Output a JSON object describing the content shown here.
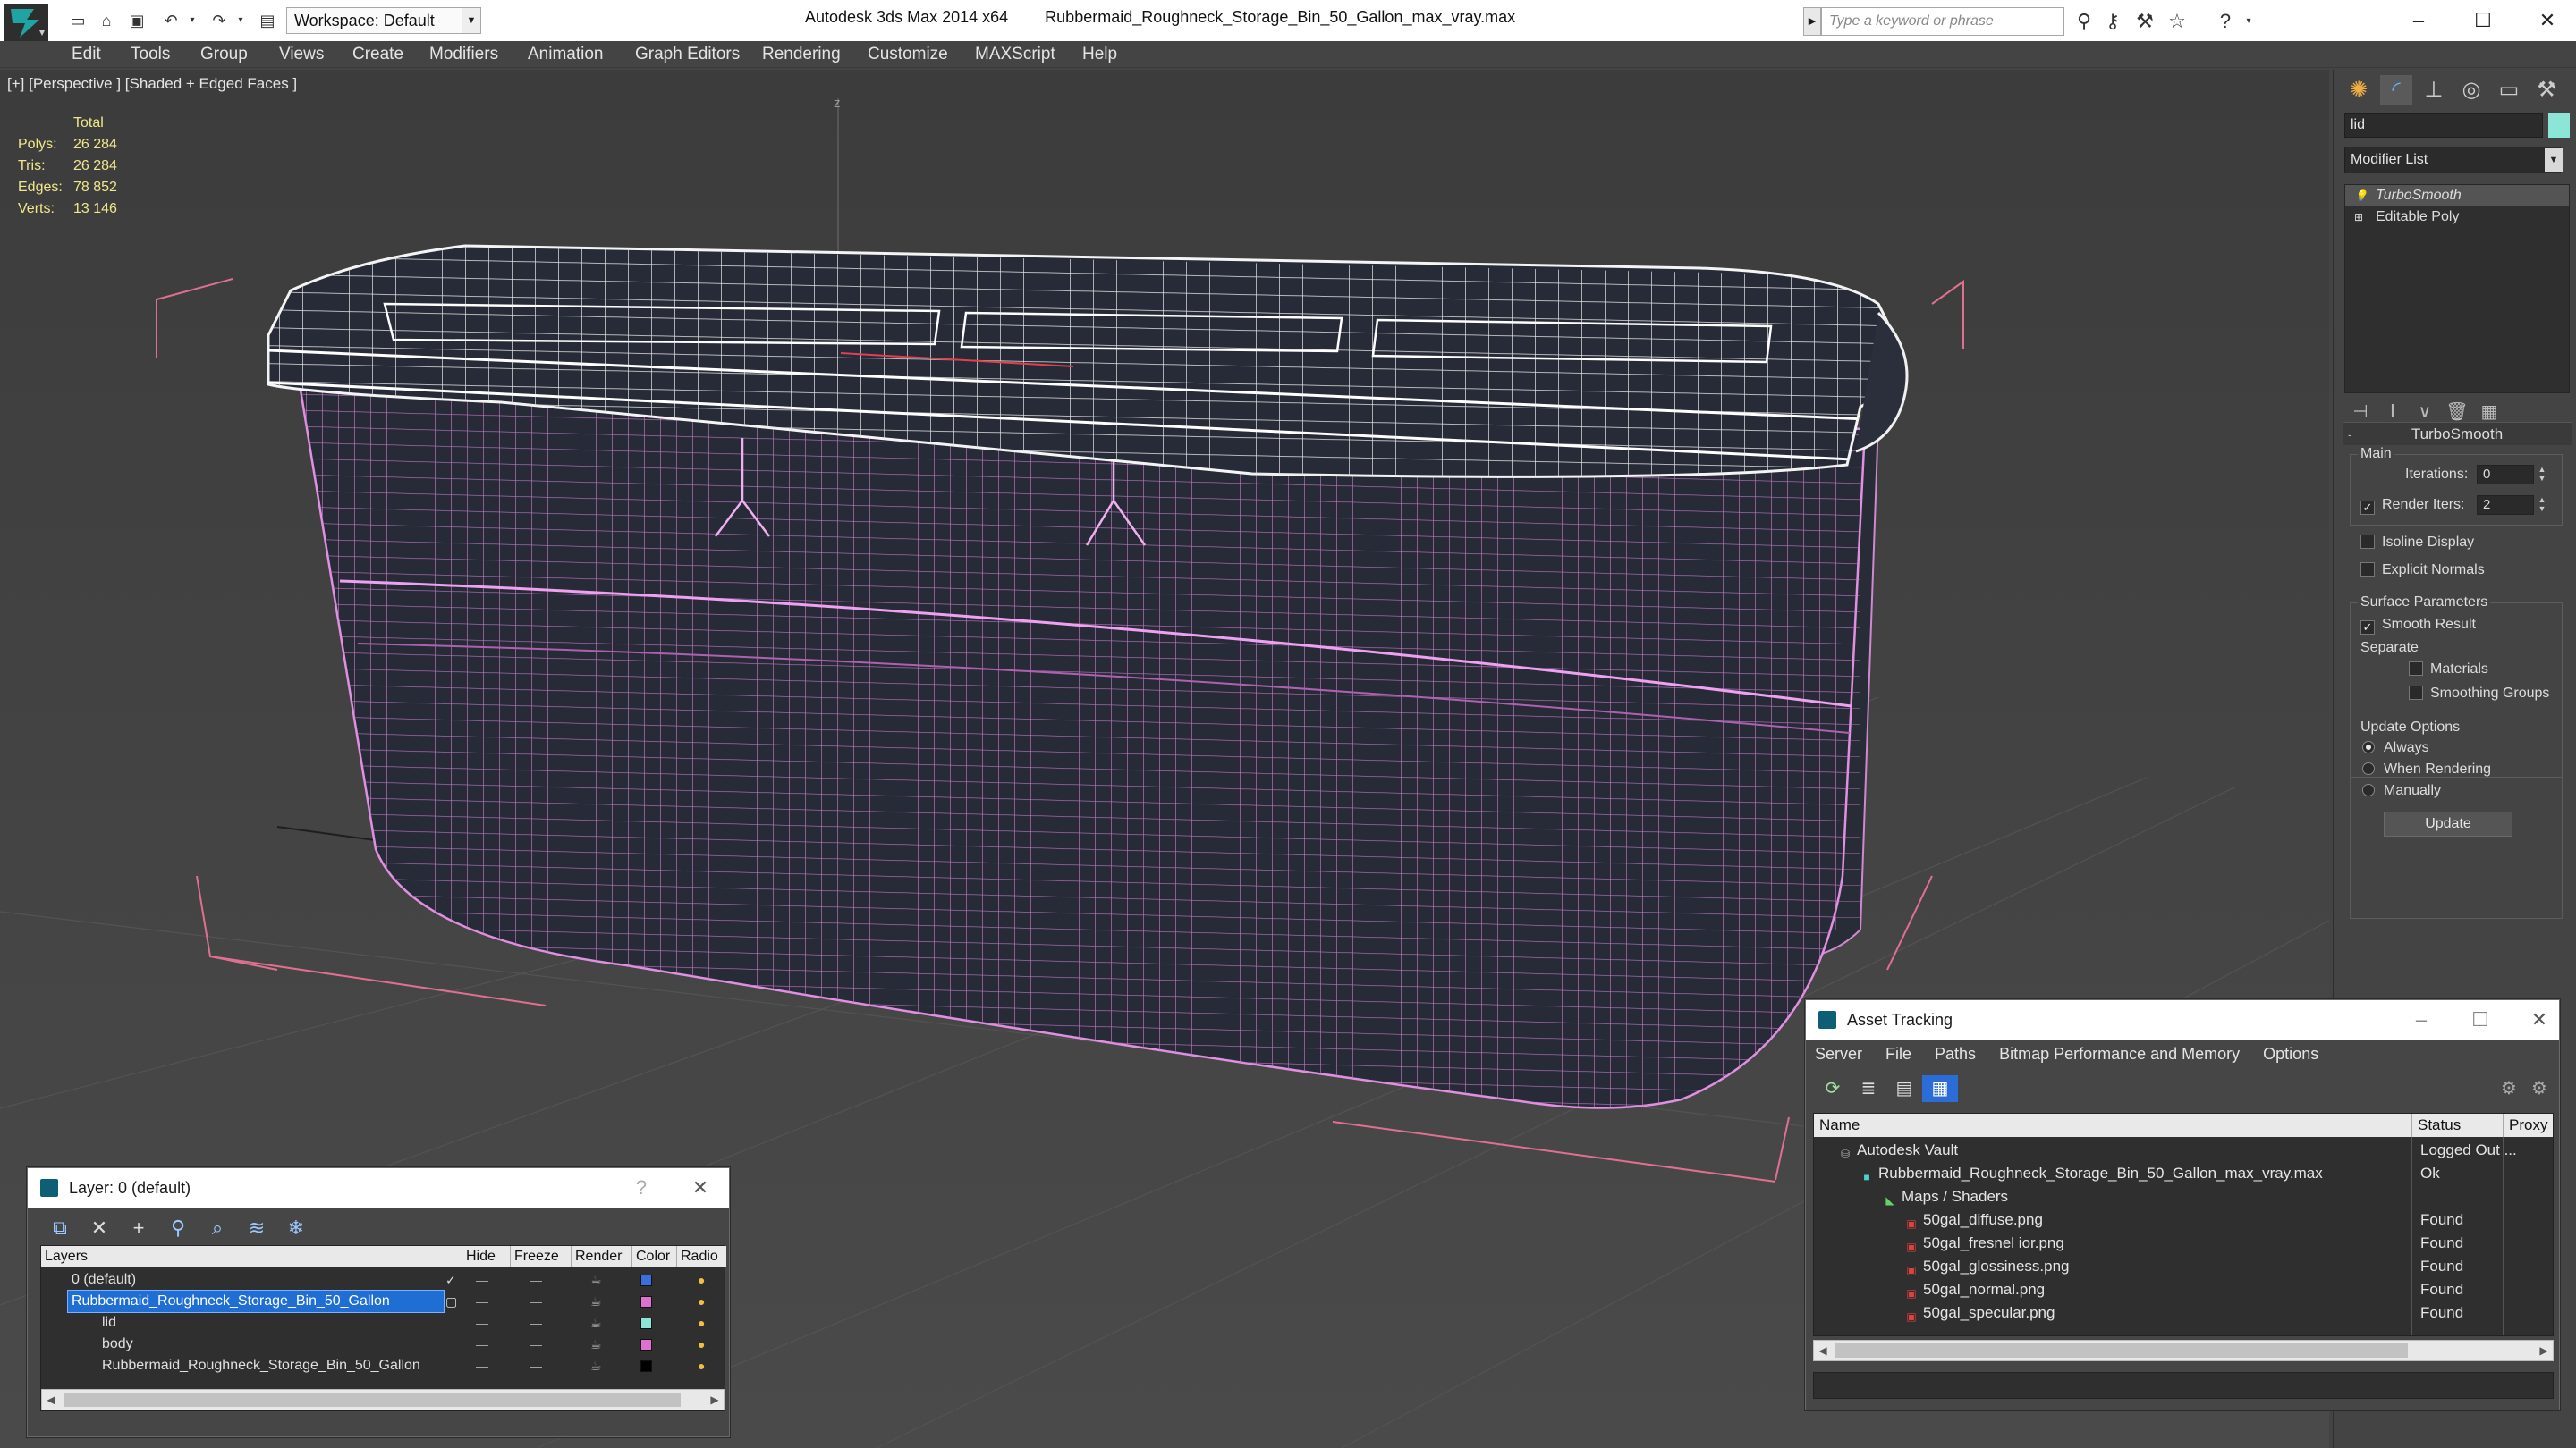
{
  "titlebar": {
    "workspace": "Workspace: Default",
    "app_name": "Autodesk 3ds Max 2014 x64",
    "file_name": "Rubbermaid_Roughneck_Storage_Bin_50_Gallon_max_vray.max",
    "search_placeholder": "Type a keyword or phrase"
  },
  "menu": [
    "Edit",
    "Tools",
    "Group",
    "Views",
    "Create",
    "Modifiers",
    "Animation",
    "Graph Editors",
    "Rendering",
    "Customize",
    "MAXScript",
    "Help"
  ],
  "viewport": {
    "label": "[+] [Perspective ] [Shaded + Edged Faces ]",
    "axis_label": "z",
    "stats": {
      "header": "Total",
      "rows": [
        {
          "label": "Polys:",
          "value": "26 284"
        },
        {
          "label": "Tris:",
          "value": "26 284"
        },
        {
          "label": "Edges:",
          "value": "78 852"
        },
        {
          "label": "Verts:",
          "value": "13 146"
        }
      ]
    }
  },
  "command_panel": {
    "object_name": "lid",
    "object_color": "#8ce6d8",
    "modifier_list": "Modifier List",
    "stack": [
      "TurboSmooth",
      "Editable Poly"
    ],
    "rollout_title": "TurboSmooth",
    "main_group": "Main",
    "iterations_label": "Iterations:",
    "iterations_value": "0",
    "render_iters_label": "Render Iters:",
    "render_iters_value": "2",
    "isoline_label": "Isoline Display",
    "explicit_normals_label": "Explicit Normals",
    "surface_group": "Surface Parameters",
    "smooth_result_label": "Smooth Result",
    "separate_label": "Separate",
    "materials_label": "Materials",
    "smoothing_groups_label": "Smoothing Groups",
    "update_group": "Update Options",
    "update_always": "Always",
    "update_rendering": "When Rendering",
    "update_manually": "Manually",
    "update_button": "Update"
  },
  "layer_dialog": {
    "title": "Layer: 0 (default)",
    "help": "?",
    "columns": [
      "Layers",
      "Hide",
      "Freeze",
      "Render",
      "Color",
      "Radio"
    ],
    "rows": [
      {
        "name": "0 (default)",
        "color": "#3b6fe0"
      },
      {
        "name": "Rubbermaid_Roughneck_Storage_Bin_50_Gallon",
        "color": "#e070d0"
      },
      {
        "name": "lid",
        "color": "#8ce6d8"
      },
      {
        "name": "body",
        "color": "#e070d0"
      },
      {
        "name": "Rubbermaid_Roughneck_Storage_Bin_50_Gallon",
        "color": "#000000"
      }
    ]
  },
  "asset_dialog": {
    "title": "Asset Tracking",
    "menu": [
      "Server",
      "File",
      "Paths",
      "Bitmap Performance and Memory",
      "Options"
    ],
    "columns": [
      "Name",
      "Status",
      "Proxy"
    ],
    "rows": [
      {
        "name": "Autodesk Vault",
        "status": "Logged Out ..."
      },
      {
        "name": "Rubbermaid_Roughneck_Storage_Bin_50_Gallon_max_vray.max",
        "status": "Ok"
      },
      {
        "name": "Maps / Shaders",
        "status": ""
      },
      {
        "name": "50gal_diffuse.png",
        "status": "Found"
      },
      {
        "name": "50gal_fresnel ior.png",
        "status": "Found"
      },
      {
        "name": "50gal_glossiness.png",
        "status": "Found"
      },
      {
        "name": "50gal_normal.png",
        "status": "Found"
      },
      {
        "name": "50gal_specular.png",
        "status": "Found"
      }
    ]
  }
}
